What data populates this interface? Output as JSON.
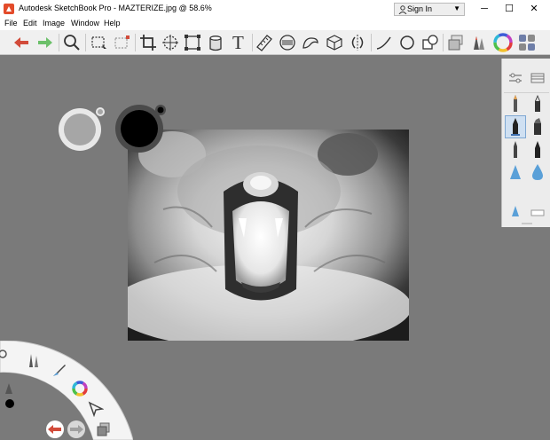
{
  "window": {
    "title": "Autodesk SketchBook Pro - MAZTERIZE.jpg @ 58.6%",
    "sign_in_label": "Sign In",
    "controls": [
      "minimize",
      "maximize",
      "close"
    ]
  },
  "menu": [
    "File",
    "Edit",
    "Image",
    "Window",
    "Help"
  ],
  "toolbar": {
    "tools": [
      "undo-icon",
      "redo-icon",
      "zoom-icon",
      "rect-select-icon",
      "lasso-select-icon",
      "crop-icon",
      "transform-icon",
      "distort-icon",
      "fill-bucket-icon",
      "text-icon",
      "ruler-icon",
      "ellipse-guide-icon",
      "french-curve-icon",
      "perspective-icon",
      "symmetry-icon",
      "stroke-icon",
      "circle-icon",
      "shape-icon",
      "layers-icon",
      "brushes-icon",
      "color-wheel-icon",
      "copic-library-icon"
    ],
    "text_tool_glyph": "T"
  },
  "colors": {
    "canvas": "#7a7a7a",
    "undo_red": "#d24b3a",
    "redo_green": "#6cc06a",
    "primary_color": "#000000",
    "secondary_color": "#a6a6a6",
    "selection_highlight": "#cfe0f2"
  },
  "canvas": {
    "document": "MAZTERIZE.jpg",
    "zoom_percent": 58.6
  },
  "brush_panel": {
    "tabs": [
      "brush-properties-icon",
      "brush-library-icon"
    ],
    "brushes": [
      "pencil",
      "ink-pen",
      "marker",
      "chisel-marker",
      "brush-pen",
      "felt-pen",
      "airbrush",
      "water-drop",
      "triangle-brush",
      "flat-eraser"
    ],
    "selected_brush": "marker"
  },
  "lagoon": {
    "tools": [
      "settings-icon",
      "brushes-icon",
      "brush-icon",
      "color-wheel-icon",
      "select-icon",
      "undo-icon",
      "redo-icon",
      "layers-icon",
      "brush-size-icon",
      "color-dot-icon"
    ]
  }
}
